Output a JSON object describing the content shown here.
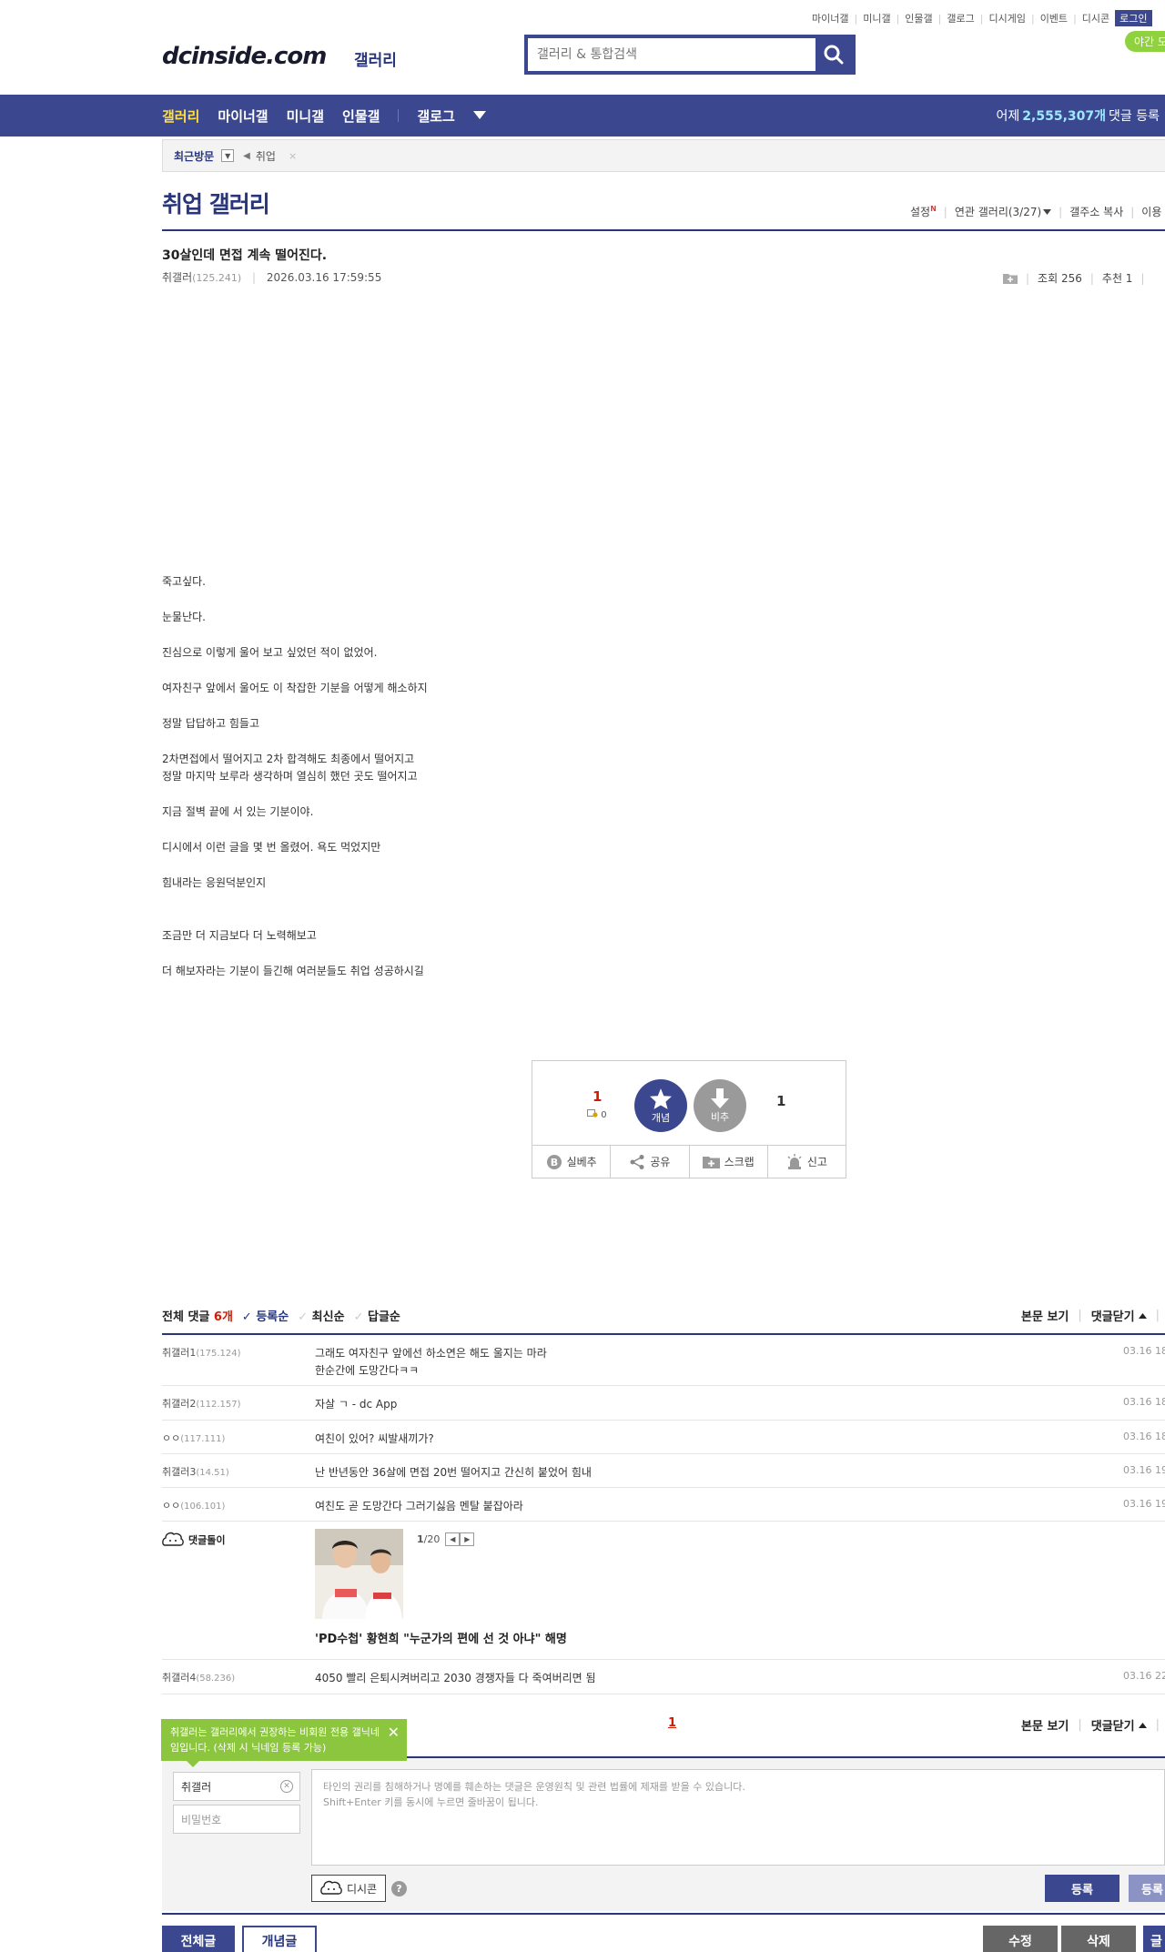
{
  "top_links": [
    "마이너갤",
    "미니갤",
    "인물갤",
    "갤로그",
    "디시게임",
    "이벤트",
    "디시콘"
  ],
  "login_label": "로그인",
  "night_mode_label": "야간 모",
  "logo_text": "dcinside.com",
  "logo_sub": "갤러리",
  "search": {
    "placeholder": "갤러리 & 통합검색"
  },
  "nav": {
    "items": [
      "갤러리",
      "마이너갤",
      "미니갤",
      "인물갤",
      "갤로그"
    ],
    "stat_prefix": "어제",
    "stat_value": "2,555,307개",
    "stat_suffix": "댓글 등록"
  },
  "recent": {
    "label": "최근방문",
    "tag": "취업",
    "close": "×"
  },
  "gallery": {
    "title": "취업 갤러리",
    "tools": [
      "설정",
      "연관 갤러리(3/27)",
      "갤주소 복사",
      "이용"
    ],
    "new_badge": "N"
  },
  "post": {
    "title": "30살인데 면접 계속 떨어진다.",
    "author": "취갤러",
    "author_ip": "(125.241)",
    "datetime": "2026.03.16 17:59:55",
    "views": "조회 256",
    "recommends": "추천 1",
    "body": [
      "죽고싶다.",
      "눈물난다.",
      "진심으로 이렇게 울어 보고 싶었던 적이 없었어.",
      "여자친구 앞에서 울어도 이 착잡한 기분을 어떻게 해소하지",
      "정말 답답하고 힘들고",
      "2차면접에서 떨어지고 2차 합격해도 최종에서 떨어지고",
      "정말 마지막 보루라 생각하며 열심히 했던 곳도 떨어지고",
      "지금 절벽 끝에 서 있는 기분이야.",
      "디시에서 이런 글을 몇 번 올렸어. 욕도 먹었지만",
      "힘내라는 응원덕분인지",
      "조금만 더 지금보다 더 노력해보고",
      "더 해보자라는 기분이 들긴해 여러분들도 취업 성공하시길"
    ]
  },
  "vote": {
    "up_count": "1",
    "fixed_count": "0",
    "up_label": "개념",
    "down_label": "비추",
    "down_count": "1",
    "actions": [
      "실베추",
      "공유",
      "스크랩",
      "신고"
    ]
  },
  "comments": {
    "total_label": "전체 댓글",
    "total_count": "6개",
    "sorts": [
      "등록순",
      "최신순",
      "답글순"
    ],
    "view_post": "본문 보기",
    "close_comments": "댓글닫기",
    "rows": [
      {
        "nick": "취갤러1",
        "ip": "(175.124)",
        "text": "그래도 여자친구 앞에선 하소연은 해도 울지는 마라",
        "text2": "한순간에 도망간다ㅋㅋ",
        "date": "03.16 18"
      },
      {
        "nick": "취갤러2",
        "ip": "(112.157)",
        "text": "자살 ㄱ - dc App",
        "date": "03.16 18"
      },
      {
        "nick": "ㅇㅇ",
        "ip": "(117.111)",
        "text": "여친이 있어? 씨발새끼가?",
        "date": "03.16 18"
      },
      {
        "nick": "취갤러3",
        "ip": "(14.51)",
        "text": "난 반년동안 36살에 면접 20번 떨어지고 간신히 붙었어 힘내",
        "date": "03.16 19"
      },
      {
        "nick": "ㅇㅇ",
        "ip": "(106.101)",
        "text": "여친도 곧 도망간다 그러기싫음 멘탈 붙잡아라",
        "date": "03.16 19"
      }
    ],
    "ad": {
      "nick": "댓글돌이",
      "page_current": "1",
      "page_total": "/20",
      "title": "'PD수첩' 황현희 \"누군가의 편에 선 것 아냐\" 해명"
    },
    "last_row": {
      "nick": "취갤러4",
      "ip": "(58.236)",
      "text": "4050 빨리 은퇴시켜버리고 2030 경쟁자들 다 죽여버리면 됨",
      "date": "03.16 22"
    },
    "page": "1"
  },
  "write": {
    "tip": "취갤러는 갤러리에서 권장하는 비회원 전용 갤닉네임입니다. (삭제 시 닉네임 등록 가능)",
    "nick_value": "취갤러",
    "password_placeholder": "비밀번호",
    "textarea_line1": "타인의 권리를 침해하거나 명예를 훼손하는 댓글은 운영원칙 및 관련 법률에 제재를 받을 수 있습니다.",
    "textarea_line2": "Shift+Enter 키를 동시에 누르면 줄바꿈이 됩니다.",
    "dccon_label": "디시콘",
    "help": "?",
    "submit": "등록",
    "submit2": "등록"
  },
  "bottom": {
    "all_posts": "전체글",
    "concept_posts": "개념글",
    "edit": "수정",
    "delete": "삭제",
    "write": "글"
  },
  "colors": {
    "brand": "#3b4890",
    "accent_red": "#d31900",
    "tip_green": "#8cc63f"
  }
}
